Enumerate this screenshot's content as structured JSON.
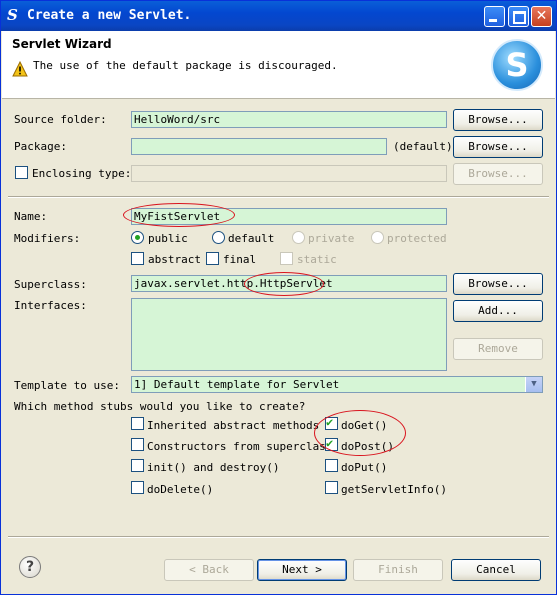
{
  "window": {
    "title": "Create a new Servlet.",
    "app_icon": "eclipse-S-glyph"
  },
  "header": {
    "title": "Servlet Wizard",
    "message": "The use of the default package is discouraged.",
    "warning_icon": "warning-triangle"
  },
  "form": {
    "source_folder": {
      "label": "Source folder:",
      "value": "HelloWord/src",
      "button": "Browse..."
    },
    "package": {
      "label": "Package:",
      "value": "",
      "hint": "(default)",
      "button": "Browse..."
    },
    "enclosing_type": {
      "label": "Enclosing type:",
      "value": "",
      "button": "Browse...",
      "checked": false
    },
    "name": {
      "label": "Name:",
      "value": "MyFistServlet"
    },
    "modifiers": {
      "label": "Modifiers:",
      "public": "public",
      "default": "default",
      "private": "private",
      "protected": "protected",
      "abstract": "abstract",
      "final": "final",
      "static": "static"
    },
    "superclass": {
      "label": "Superclass:",
      "value": "javax.servlet.http.HttpServlet",
      "button": "Browse..."
    },
    "interfaces": {
      "label": "Interfaces:",
      "add_button": "Add...",
      "remove_button": "Remove"
    },
    "template": {
      "label": "Template to use:",
      "value": "1] Default template for Servlet"
    },
    "stubs_question": "Which method stubs would you like to create?",
    "stubs": {
      "inherited": {
        "label": "Inherited abstract methods",
        "checked": false
      },
      "constructors": {
        "label": "Constructors from superclass",
        "checked": false
      },
      "init": {
        "label": "init() and destroy()",
        "checked": false
      },
      "doDelete": {
        "label": "doDelete()",
        "checked": false
      },
      "doGet": {
        "label": "doGet()",
        "checked": true
      },
      "doPost": {
        "label": "doPost()",
        "checked": true
      },
      "doPut": {
        "label": "doPut()",
        "checked": false
      },
      "getServletInfo": {
        "label": "getServletInfo()",
        "checked": false
      }
    }
  },
  "footer": {
    "back": "< Back",
    "next": "Next >",
    "finish": "Finish",
    "cancel": "Cancel"
  },
  "colors": {
    "field_bg": "#d6f5d6",
    "title_bar": "#0a46c4",
    "annotation": "#d9141e"
  }
}
